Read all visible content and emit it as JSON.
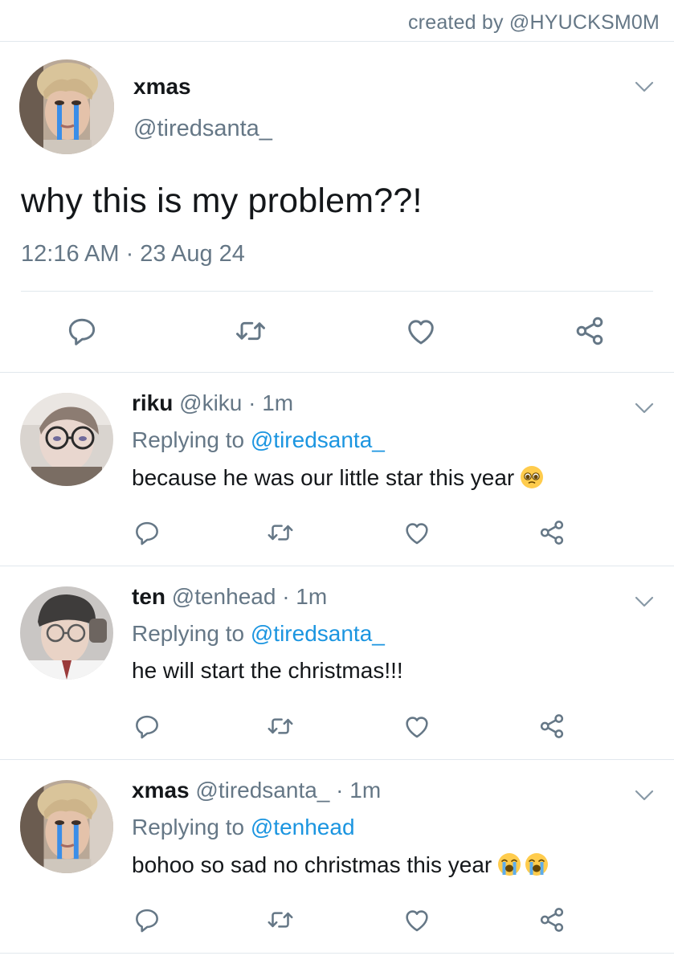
{
  "credit": "created by @HYUCKSM0M",
  "main": {
    "name": "xmas",
    "handle": "@tiredsanta_",
    "text": "why this is my problem??!",
    "timestamp": "12:16 AM · 23 Aug 24",
    "avatar": "crying-face-photo-avatar"
  },
  "replies": [
    {
      "name": "riku",
      "meta": " @kiku · 1m",
      "replying_prefix": "Replying to ",
      "replying_to": "@tiredsanta_",
      "text": "because he was our little star this year",
      "emoji": [
        "pleading-face"
      ],
      "avatar": "glasses-photo-avatar"
    },
    {
      "name": "ten",
      "meta": " @tenhead · 1m",
      "replying_prefix": "Replying to ",
      "replying_to": "@tiredsanta_",
      "text": "he will start the christmas!!!",
      "emoji": [],
      "avatar": "beanie-photo-avatar"
    },
    {
      "name": "xmas",
      "meta": " @tiredsanta_ · 1m",
      "replying_prefix": "Replying to ",
      "replying_to": "@tenhead",
      "text": "bohoo so sad no christmas this year",
      "emoji": [
        "loudly-crying-face",
        "loudly-crying-face"
      ],
      "avatar": "crying-face-photo-avatar"
    }
  ],
  "actions": [
    "reply-icon",
    "retweet-icon",
    "like-icon",
    "share-icon"
  ],
  "colors": {
    "text": "#14171a",
    "muted": "#657786",
    "link": "#1b95e0",
    "border": "#e1e8ed"
  }
}
